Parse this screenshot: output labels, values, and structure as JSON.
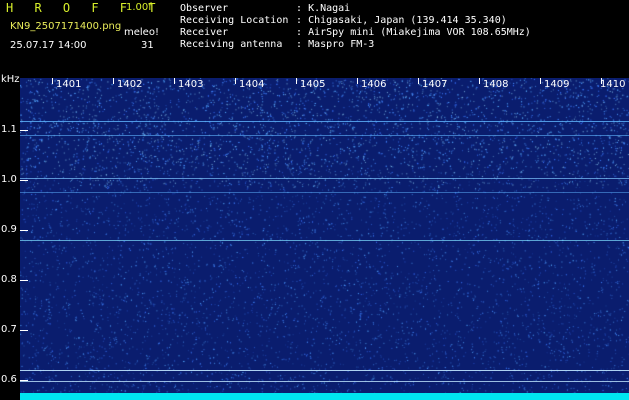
{
  "header": {
    "brand": "H R O F F T",
    "version": "1.00f",
    "filename": "KN9_2507171400.png",
    "datetime": "25.07.17 14:00",
    "meleo_label": "meleo!",
    "meleo_count": "31"
  },
  "info": [
    {
      "key": "Observer",
      "sep": ":",
      "value": "K.Nagai"
    },
    {
      "key": "Receiving Location",
      "sep": ":",
      "value": "Chigasaki, Japan (139.414 35.340)"
    },
    {
      "key": "Receiver",
      "sep": ":",
      "value": "AirSpy mini (Miakejima VOR 108.65MHz)"
    },
    {
      "key": "Receiving antenna",
      "sep": ":",
      "value": "Maspro FM-3"
    }
  ],
  "spectrogram": {
    "y_unit": "kHz",
    "y_ticks": [
      "1.1",
      "1.0",
      "0.9",
      "0.8",
      "0.7",
      "0.6"
    ],
    "x_ticks": [
      "1401",
      "1402",
      "1403",
      "1404",
      "1405",
      "1406",
      "1407",
      "1408",
      "1409",
      "1410"
    ],
    "background_color": "#0a1d6e",
    "noise_color": "#3a8cff",
    "floor_color": "#00e5f0"
  }
}
